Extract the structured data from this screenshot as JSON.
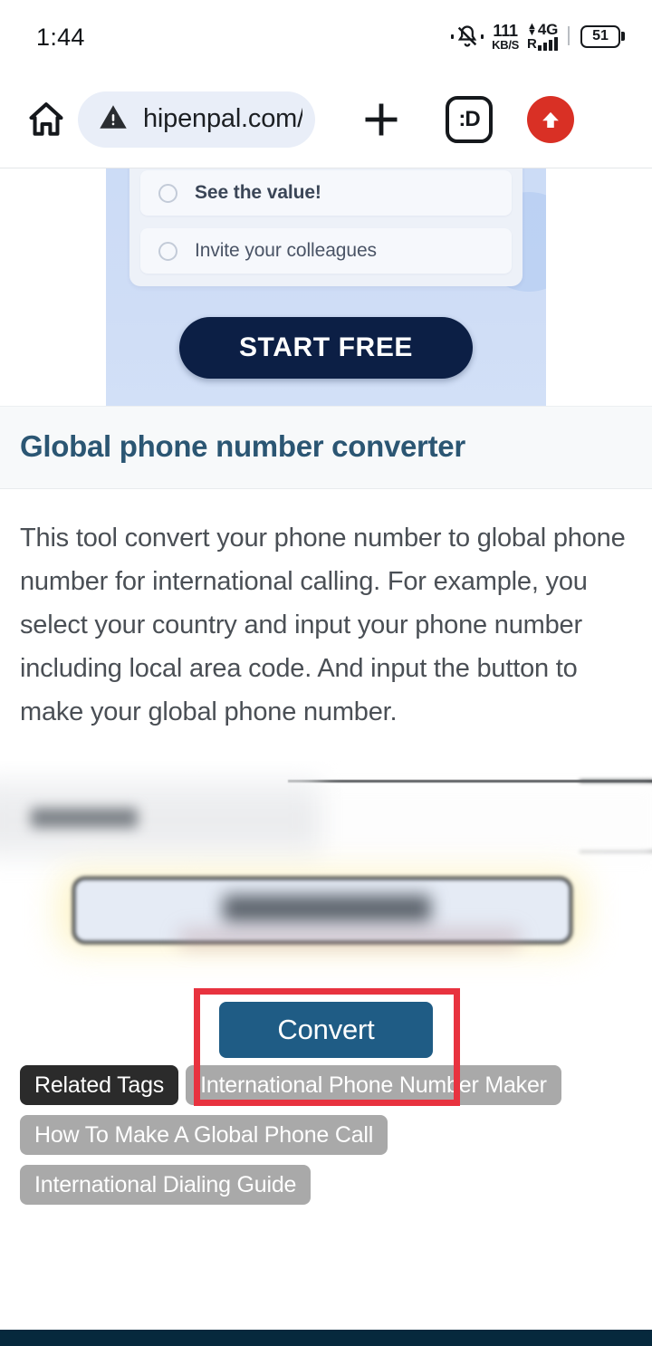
{
  "status_bar": {
    "clock": "1:44",
    "network_speed_value": "111",
    "network_speed_unit": "KB/S",
    "network_type": "4G",
    "roaming": "R",
    "battery_level": "51",
    "icons": [
      "bell-mute-icon",
      "data-arrows-icon",
      "signal-bars-icon",
      "battery-icon"
    ]
  },
  "browser": {
    "home_icon": "home-icon",
    "security_icon": "warning-triangle-icon",
    "url": "hipenpal.com/to",
    "new_tab_icon": "plus-icon",
    "tab_count_label": ":D",
    "update_icon": "up-arrow-icon",
    "accent_red": "#d93025"
  },
  "ad": {
    "options": [
      {
        "label": "See the value!"
      },
      {
        "label": "Invite your colleagues"
      }
    ],
    "cta_label": "START FREE",
    "cta_color": "#0c1f45",
    "background_color": "#ccdcf6"
  },
  "article": {
    "heading": "Global phone number converter",
    "heading_color": "#2b5673",
    "paragraph": "This tool convert your phone number to global phone number for international calling. For example, you select your country and input your phone number including local area code. And input the button to make your global phone number."
  },
  "form": {
    "country_select_value": "Argentina",
    "phone_input_value": "",
    "phone_input_placeholder": "",
    "convert_button_label": "Convert",
    "convert_button_color": "#1f5c85",
    "highlight_box_color": "#e8333f",
    "focus_glow_color": "#fdf4c8"
  },
  "tags": {
    "title": "Related Tags",
    "items": [
      "International Phone Number Maker",
      "How To Make A Global Phone Call",
      "International Dialing Guide"
    ],
    "title_color": "#2b2b2b",
    "item_color": "#a9a9a9"
  },
  "footer": {
    "color": "#06293d"
  }
}
